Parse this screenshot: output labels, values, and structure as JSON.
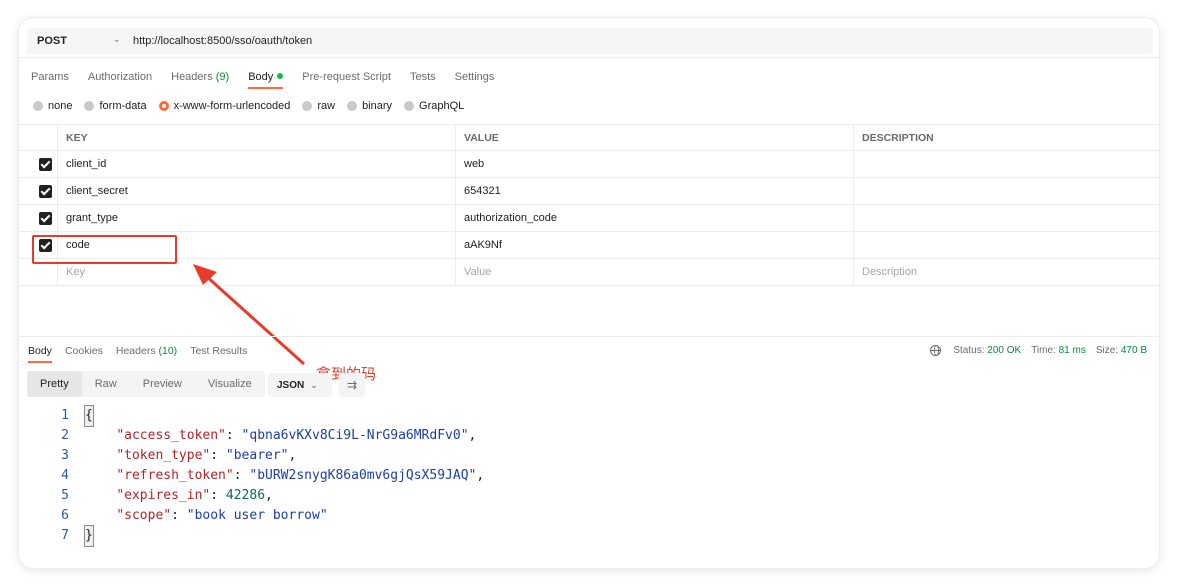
{
  "request": {
    "method": "POST",
    "url": "http://localhost:8500/sso/oauth/token",
    "tabs": [
      {
        "label": "Params"
      },
      {
        "label": "Authorization"
      },
      {
        "label": "Headers",
        "count": "(9)"
      },
      {
        "label": "Body"
      },
      {
        "label": "Pre-request Script"
      },
      {
        "label": "Tests"
      },
      {
        "label": "Settings"
      }
    ],
    "body_types": [
      "none",
      "form-data",
      "x-www-form-urlencoded",
      "raw",
      "binary",
      "GraphQL"
    ],
    "selected_body_type": "x-www-form-urlencoded"
  },
  "params_table": {
    "headers": {
      "key": "KEY",
      "value": "VALUE",
      "description": "DESCRIPTION"
    },
    "rows": [
      {
        "key": "client_id",
        "value": "web",
        "description": "",
        "checked": true
      },
      {
        "key": "client_secret",
        "value": "654321",
        "description": "",
        "checked": true
      },
      {
        "key": "grant_type",
        "value": "authorization_code",
        "description": "",
        "checked": true
      },
      {
        "key": "code",
        "value": "aAK9Nf",
        "description": "",
        "checked": true
      }
    ],
    "placeholder": {
      "key": "Key",
      "value": "Value",
      "description": "Description"
    }
  },
  "annotation": {
    "text": "拿到的码",
    "color": "#e83a2a"
  },
  "response": {
    "tabs": [
      {
        "label": "Body"
      },
      {
        "label": "Cookies"
      },
      {
        "label": "Headers",
        "count": "(10)"
      },
      {
        "label": "Test Results"
      }
    ],
    "status_label": "Status:",
    "status_value": "200 OK",
    "time_label": "Time:",
    "time_value": "81 ms",
    "size_label": "Size:",
    "size_value": "470 B",
    "views": [
      "Pretty",
      "Raw",
      "Preview",
      "Visualize"
    ],
    "format": "JSON",
    "json_lines": [
      {
        "num": "1",
        "text": "{"
      },
      {
        "num": "2",
        "key": "\"access_token\"",
        "value": "\"qbna6vKXv8Ci9L-NrG9a6MRdFv0\"",
        "tail": ","
      },
      {
        "num": "3",
        "key": "\"token_type\"",
        "value": "\"bearer\"",
        "tail": ","
      },
      {
        "num": "4",
        "key": "\"refresh_token\"",
        "value": "\"bURW2snygK86a0mv6gjQsX59JAQ\"",
        "tail": ","
      },
      {
        "num": "5",
        "key": "\"expires_in\"",
        "number": "42286",
        "tail": ","
      },
      {
        "num": "6",
        "key": "\"scope\"",
        "value": "\"book user borrow\"",
        "tail": ""
      },
      {
        "num": "7",
        "text": "}"
      }
    ]
  },
  "colors": {
    "accent": "#ff6c37",
    "success": "#0b8a3e",
    "annotation": "#e83a2a"
  }
}
